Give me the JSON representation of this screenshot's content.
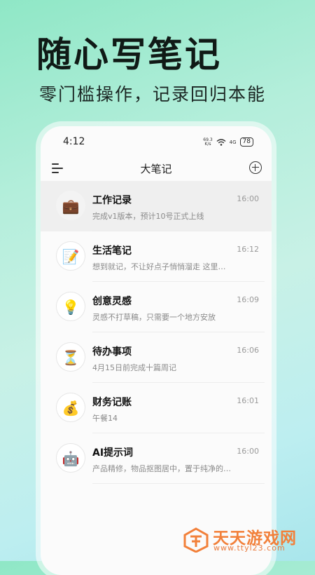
{
  "headline": "随心写笔记",
  "subline": "零门槛操作，记录回归本能",
  "status_bar": {
    "time": "4:12",
    "net_speed_top": "69.3",
    "net_speed_bottom": "K/s",
    "signal": "4G",
    "battery": "78"
  },
  "app_bar": {
    "title": "大笔记",
    "menu_icon": "hamburger-icon",
    "add_icon": "plus-circle-icon"
  },
  "notes": [
    {
      "icon": "💼",
      "icon_name": "briefcase-icon",
      "title": "工作记录",
      "preview": "完成v1版本，预计10号正式上线",
      "time": "16:00"
    },
    {
      "icon": "📝",
      "icon_name": "memo-icon",
      "title": "生活笔记",
      "preview": "想到就记，不让好点子悄悄溜走 这里存放…",
      "time": "16:12"
    },
    {
      "icon": "💡",
      "icon_name": "lightbulb-icon",
      "title": "创意灵感",
      "preview": "灵感不打草稿，只需要一个地方安放",
      "time": "16:09"
    },
    {
      "icon": "⏳",
      "icon_name": "hourglass-icon",
      "title": "待办事项",
      "preview": "4月15日前完成十篇周记",
      "time": "16:06"
    },
    {
      "icon": "💰",
      "icon_name": "money-bag-icon",
      "title": "财务记账",
      "preview": "午餐14",
      "time": "16:01"
    },
    {
      "icon": "🤖",
      "icon_name": "robot-icon",
      "title": "AI提示词",
      "preview": "产品精修，物品抠图居中，置于纯净的白色…",
      "time": "16:00"
    }
  ],
  "watermark": {
    "name": "天天游戏网",
    "url": "www.ttyl23.com"
  }
}
